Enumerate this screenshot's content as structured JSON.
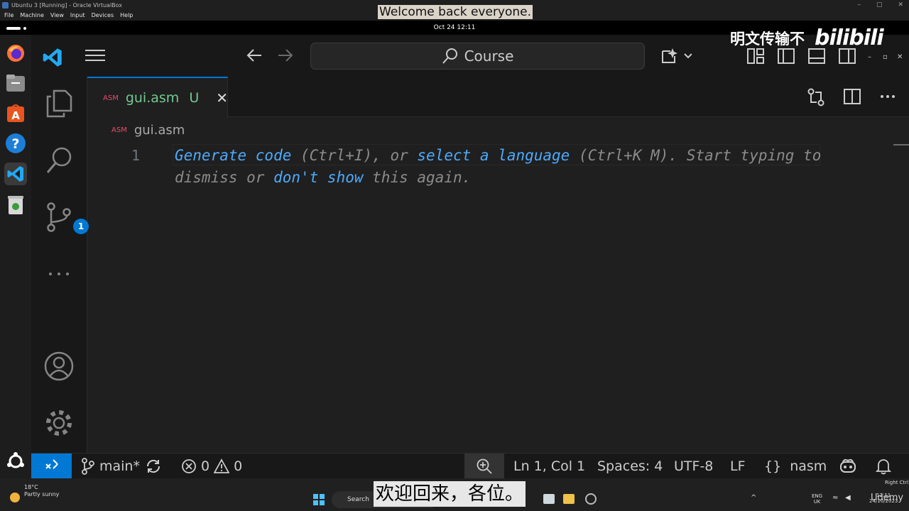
{
  "vbox": {
    "title": "Ubuntu 3 [Running] - Oracle VirtualBox",
    "menu": [
      "File",
      "Machine",
      "View",
      "Input",
      "Devices",
      "Help"
    ]
  },
  "gnome": {
    "datetime": "Oct 24  12:11"
  },
  "vscode": {
    "command_center": "Course",
    "tab": {
      "tag": "ASM",
      "name": "gui.asm",
      "status": "U"
    },
    "breadcrumb": {
      "tag": "ASM",
      "name": "gui.asm"
    },
    "editor": {
      "line_number": "1",
      "hint": {
        "generate": "Generate code",
        "ctrl_i": " (Ctrl+I), or ",
        "select_language": "select a language",
        "ctrl_k": " (Ctrl+K M). Start typing to dismiss or ",
        "dont_show": "don't show",
        "tail": " this again."
      }
    },
    "scm_badge": "1",
    "status": {
      "branch": "main*",
      "errors": "0",
      "warnings": "0",
      "position": "Ln 1, Col 1",
      "spaces": "Spaces: 4",
      "encoding": "UTF-8",
      "eol": "LF",
      "language": "nasm"
    }
  },
  "taskbar": {
    "temperature": "18°C",
    "weather": "Partly sunny",
    "search": "Search",
    "lang_top": "ENG",
    "lang_bottom": "UK",
    "time": "12:11",
    "date": "24/10/2023",
    "right_ctrl": "Right Ctrl"
  },
  "overlay": {
    "subtitle_en": "Welcome back everyone.",
    "subtitle_zh": "欢迎回来，各位。",
    "watermark_text": "明文传输不",
    "bilibili": "bilibili",
    "udemy": "Udemy"
  },
  "colors": {
    "accent": "#0078d4",
    "link": "#4daafc",
    "untracked": "#73c991",
    "asm_tag": "#e54d6d"
  }
}
